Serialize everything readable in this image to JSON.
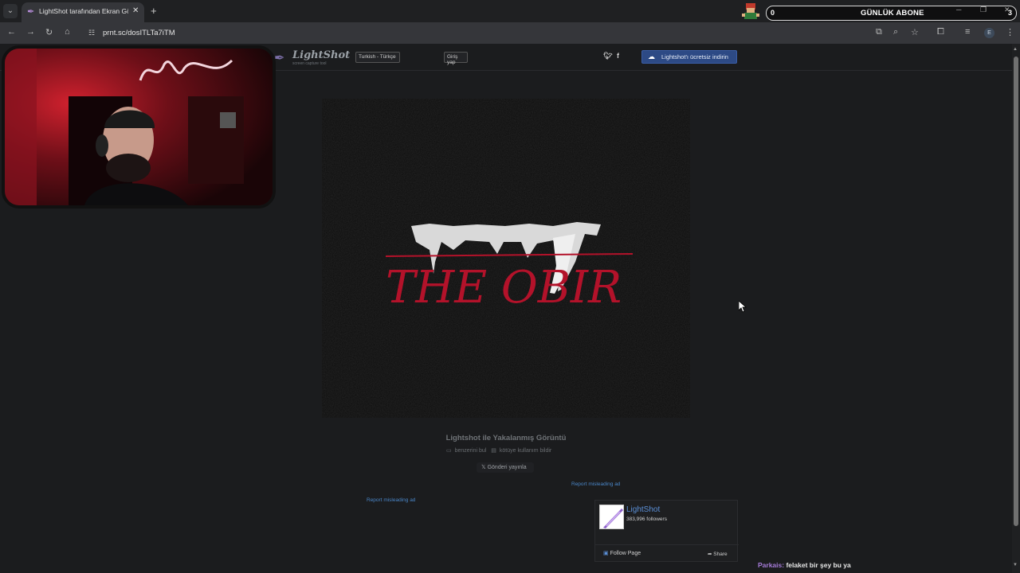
{
  "browser": {
    "tab_title": "LightShot tarafından Ekran Görüntüsü",
    "new_tab_label": "+",
    "url": "prnt.sc/dosITLTa7iTM",
    "profile_initial": "E"
  },
  "overlay": {
    "abone_left": "0",
    "abone_title": "GÜNLÜK ABONE",
    "abone_right": "3"
  },
  "lightshot": {
    "logo": "LightShot",
    "logo_sub": "screen capture tool",
    "language": "Turkish - Türkçe",
    "login": "Giriş yap",
    "download": "Lightshot'ı ücretsiz indirin",
    "caption": "Lightshot ile Yakalanmış Görüntü",
    "find_similar": "benzerini bul",
    "report_abuse": "kötüye kullanım bildir",
    "tweet": "Gönderi yayınla",
    "report_ad_1": "Report misleading ad",
    "report_ad_2": "Report misleading ad"
  },
  "shot_image": {
    "text": "THE OBIR"
  },
  "facebook": {
    "name": "LightShot",
    "followers": "383,996 followers",
    "follow": "Follow Page",
    "share": "Share"
  },
  "chat": {
    "user": "Parkais:",
    "message": "felaket bir şey bu ya"
  },
  "colors": {
    "accent": "#2d4a85",
    "link": "#4a86c8",
    "chat_user": "#a57bd8"
  }
}
